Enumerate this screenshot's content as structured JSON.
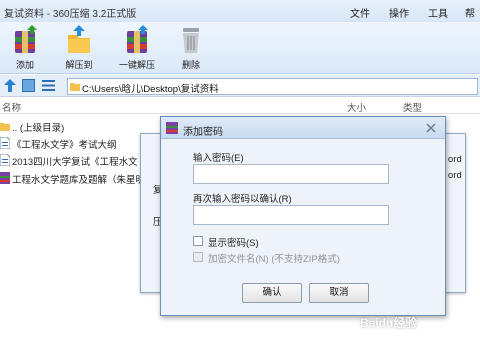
{
  "app": {
    "title": "复试资料 - 360压缩 3.2正式版"
  },
  "menu": {
    "file": "文件",
    "operate": "操作",
    "tools": "工具",
    "help": "帮助"
  },
  "toolbar": {
    "add": "添加",
    "extract_to": "解压到",
    "one_click_extract": "一键解压",
    "delete": "删除"
  },
  "address": {
    "path": "C:\\Users\\晗儿\\Desktop\\复试资料"
  },
  "columns": {
    "name": "名称",
    "size": "大小",
    "type": "类型"
  },
  "files": [
    {
      "name": ".. (上级目录)"
    },
    {
      "name": "《工程水文学》考试大纲"
    },
    {
      "name": "2013四川大学复试《工程水文"
    },
    {
      "name": "工程水文学题库及题解（朱星明"
    }
  ],
  "behind_dialog": {
    "frag_1": "复",
    "frag_2": "压",
    "frag_3": "ord",
    "frag_4": "ord"
  },
  "dialog": {
    "title": "添加密码",
    "enter_label": "输入密码(E)",
    "confirm_label": "再次输入密码以确认(R)",
    "show_password": "显示密码(S)",
    "encrypt_names": "加密文件名(N) (不支持ZIP格式)",
    "ok": "确认",
    "cancel": "取消",
    "enter_value": "",
    "confirm_value": ""
  },
  "watermark": {
    "text": "Baidu经验"
  },
  "colors": {
    "accent": "#2f6db5",
    "toolbar_bg": "#dbe9f8"
  },
  "icons": [
    "add-archive-icon",
    "extract-to-icon",
    "one-click-extract-icon",
    "delete-trash-icon",
    "up-arrow-icon",
    "view-icon",
    "list-icon",
    "folder-icon",
    "doc-icon",
    "rar-icon",
    "dialog-app-icon"
  ]
}
